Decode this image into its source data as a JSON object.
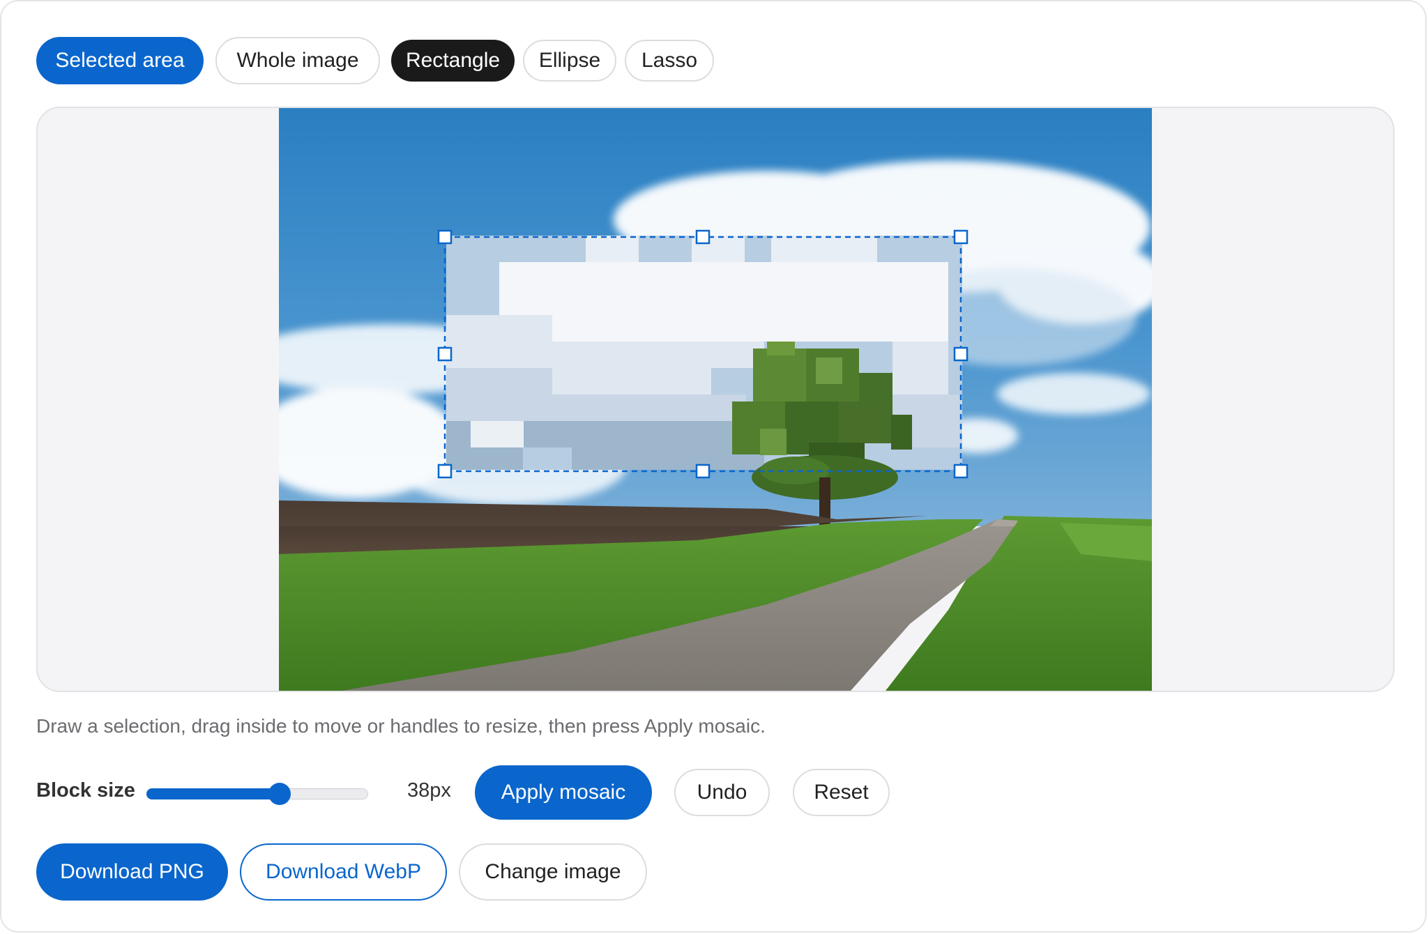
{
  "tabs": {
    "selected_area": "Selected area",
    "whole_image": "Whole image",
    "rectangle": "Rectangle",
    "ellipse": "Ellipse",
    "lasso": "Lasso"
  },
  "hint": "Draw a selection, drag inside to move or handles to resize, then press Apply mosaic.",
  "controls": {
    "block_size_label": "Block size",
    "block_size_value": "38px",
    "block_size_level": 0.6,
    "apply": "Apply mosaic",
    "undo": "Undo",
    "reset": "Reset"
  },
  "actions": {
    "download_png": "Download PNG",
    "download_webp": "Download WebP",
    "change_image": "Change image"
  },
  "colors": {
    "accent": "#0a66cc",
    "selected_shape": "#1a1a1a"
  }
}
